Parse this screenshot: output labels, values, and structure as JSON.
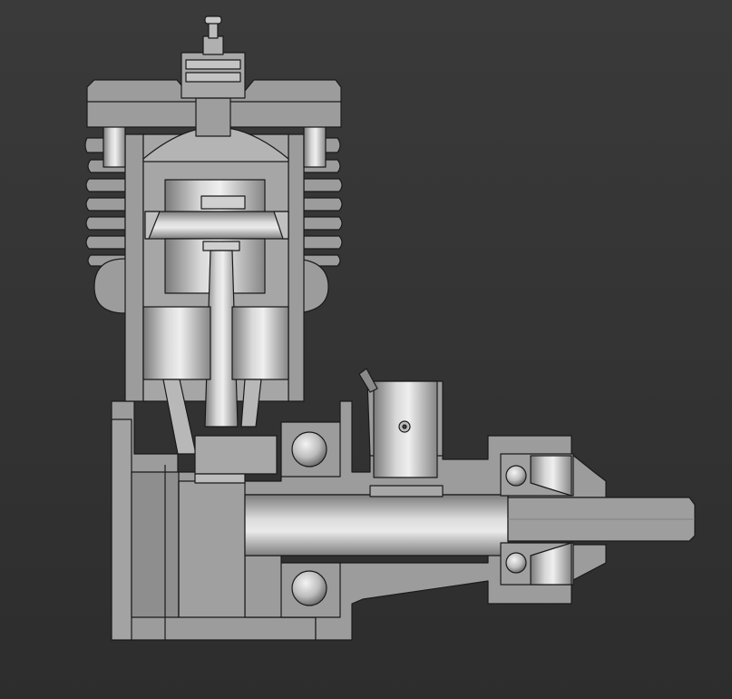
{
  "viewer": {
    "background_top": "#3a3a3a",
    "background_bottom": "#2d2d2d"
  },
  "model": {
    "section_face_color": "#9c9c9c",
    "edge_color": "#1a1a1a",
    "cavity_color": "#4a4a4a",
    "parts": [
      "glow-plug",
      "cylinder-head",
      "cooling-fins",
      "cylinder-liner",
      "piston",
      "wrist-pin",
      "connecting-rod",
      "crankcase",
      "carburetor-intake",
      "front-ball-bearing",
      "rear-ball-bearing",
      "crankshaft",
      "propeller-shaft",
      "prop-drive-washer",
      "needle-valve"
    ]
  }
}
